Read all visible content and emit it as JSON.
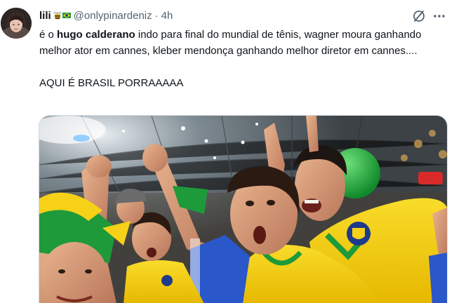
{
  "author": {
    "display_name": "lili",
    "name_emoji": "🐝🇧🇷",
    "handle": "@onlypinardeniz",
    "separator": "·",
    "time": "4h"
  },
  "icons": {
    "grok": "grok-slash-circle-icon",
    "more": "more-dots-icon"
  },
  "text": {
    "line1_pre": "é o ",
    "line1_bold": "hugo calderano",
    "line1_post": " indo para final do mundial de tênis, wagner moura ganhando melhor ator em cannes, kleber mendonça ganhando melhor diretor em cannes....",
    "line2": "AQUI É BRASIL PORRAAAAA"
  },
  "colors": {
    "brazil_yellow": "#f7d117",
    "brazil_green": "#1e9a3a",
    "text_secondary": "#536471"
  }
}
